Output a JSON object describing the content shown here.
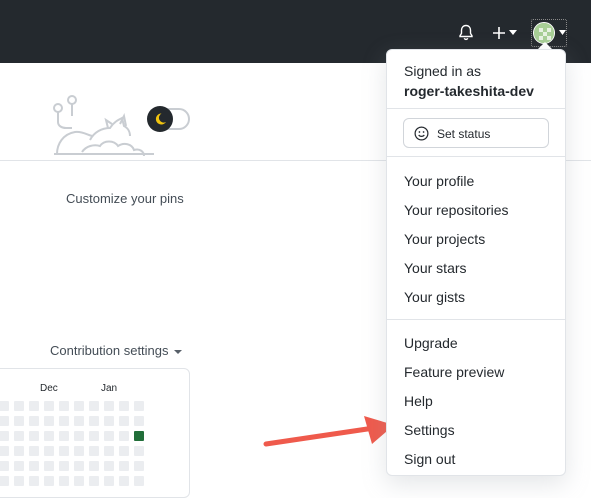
{
  "header": {
    "icons": [
      "bell-icon",
      "plus-icon",
      "chevron-down-icon",
      "avatar"
    ]
  },
  "main": {
    "customize_pins": "Customize your pins",
    "contribution_settings": "Contribution settings",
    "graph_months": [
      "Dec",
      "Jan"
    ]
  },
  "dropdown": {
    "signed_in_as": "Signed in as",
    "username": "roger-takeshita-dev",
    "set_status": "Set status",
    "profile_items": [
      "Your profile",
      "Your repositories",
      "Your projects",
      "Your stars",
      "Your gists"
    ],
    "account_items": [
      "Upgrade",
      "Feature preview",
      "Help",
      "Settings",
      "Sign out"
    ]
  },
  "colors": {
    "topbar": "#24292e",
    "contribution_green": "#216e39",
    "annotation_arrow": "#ef5a4c"
  }
}
